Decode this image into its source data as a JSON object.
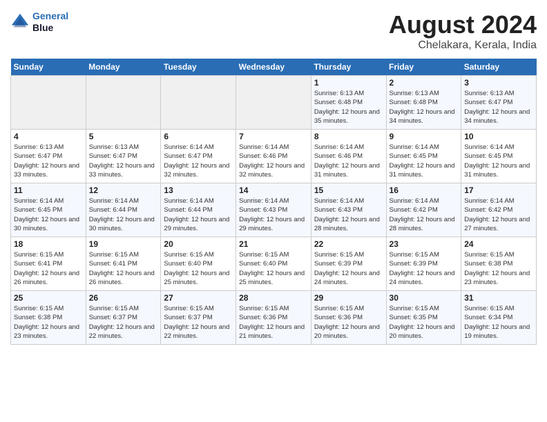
{
  "header": {
    "logo_line1": "General",
    "logo_line2": "Blue",
    "title": "August 2024",
    "subtitle": "Chelakara, Kerala, India"
  },
  "days_of_week": [
    "Sunday",
    "Monday",
    "Tuesday",
    "Wednesday",
    "Thursday",
    "Friday",
    "Saturday"
  ],
  "weeks": [
    [
      {
        "day": "",
        "info": ""
      },
      {
        "day": "",
        "info": ""
      },
      {
        "day": "",
        "info": ""
      },
      {
        "day": "",
        "info": ""
      },
      {
        "day": "1",
        "info": "Sunrise: 6:13 AM\nSunset: 6:48 PM\nDaylight: 12 hours and 35 minutes."
      },
      {
        "day": "2",
        "info": "Sunrise: 6:13 AM\nSunset: 6:48 PM\nDaylight: 12 hours and 34 minutes."
      },
      {
        "day": "3",
        "info": "Sunrise: 6:13 AM\nSunset: 6:47 PM\nDaylight: 12 hours and 34 minutes."
      }
    ],
    [
      {
        "day": "4",
        "info": "Sunrise: 6:13 AM\nSunset: 6:47 PM\nDaylight: 12 hours and 33 minutes."
      },
      {
        "day": "5",
        "info": "Sunrise: 6:13 AM\nSunset: 6:47 PM\nDaylight: 12 hours and 33 minutes."
      },
      {
        "day": "6",
        "info": "Sunrise: 6:14 AM\nSunset: 6:47 PM\nDaylight: 12 hours and 32 minutes."
      },
      {
        "day": "7",
        "info": "Sunrise: 6:14 AM\nSunset: 6:46 PM\nDaylight: 12 hours and 32 minutes."
      },
      {
        "day": "8",
        "info": "Sunrise: 6:14 AM\nSunset: 6:46 PM\nDaylight: 12 hours and 31 minutes."
      },
      {
        "day": "9",
        "info": "Sunrise: 6:14 AM\nSunset: 6:45 PM\nDaylight: 12 hours and 31 minutes."
      },
      {
        "day": "10",
        "info": "Sunrise: 6:14 AM\nSunset: 6:45 PM\nDaylight: 12 hours and 31 minutes."
      }
    ],
    [
      {
        "day": "11",
        "info": "Sunrise: 6:14 AM\nSunset: 6:45 PM\nDaylight: 12 hours and 30 minutes."
      },
      {
        "day": "12",
        "info": "Sunrise: 6:14 AM\nSunset: 6:44 PM\nDaylight: 12 hours and 30 minutes."
      },
      {
        "day": "13",
        "info": "Sunrise: 6:14 AM\nSunset: 6:44 PM\nDaylight: 12 hours and 29 minutes."
      },
      {
        "day": "14",
        "info": "Sunrise: 6:14 AM\nSunset: 6:43 PM\nDaylight: 12 hours and 29 minutes."
      },
      {
        "day": "15",
        "info": "Sunrise: 6:14 AM\nSunset: 6:43 PM\nDaylight: 12 hours and 28 minutes."
      },
      {
        "day": "16",
        "info": "Sunrise: 6:14 AM\nSunset: 6:42 PM\nDaylight: 12 hours and 28 minutes."
      },
      {
        "day": "17",
        "info": "Sunrise: 6:14 AM\nSunset: 6:42 PM\nDaylight: 12 hours and 27 minutes."
      }
    ],
    [
      {
        "day": "18",
        "info": "Sunrise: 6:15 AM\nSunset: 6:41 PM\nDaylight: 12 hours and 26 minutes."
      },
      {
        "day": "19",
        "info": "Sunrise: 6:15 AM\nSunset: 6:41 PM\nDaylight: 12 hours and 26 minutes."
      },
      {
        "day": "20",
        "info": "Sunrise: 6:15 AM\nSunset: 6:40 PM\nDaylight: 12 hours and 25 minutes."
      },
      {
        "day": "21",
        "info": "Sunrise: 6:15 AM\nSunset: 6:40 PM\nDaylight: 12 hours and 25 minutes."
      },
      {
        "day": "22",
        "info": "Sunrise: 6:15 AM\nSunset: 6:39 PM\nDaylight: 12 hours and 24 minutes."
      },
      {
        "day": "23",
        "info": "Sunrise: 6:15 AM\nSunset: 6:39 PM\nDaylight: 12 hours and 24 minutes."
      },
      {
        "day": "24",
        "info": "Sunrise: 6:15 AM\nSunset: 6:38 PM\nDaylight: 12 hours and 23 minutes."
      }
    ],
    [
      {
        "day": "25",
        "info": "Sunrise: 6:15 AM\nSunset: 6:38 PM\nDaylight: 12 hours and 23 minutes."
      },
      {
        "day": "26",
        "info": "Sunrise: 6:15 AM\nSunset: 6:37 PM\nDaylight: 12 hours and 22 minutes."
      },
      {
        "day": "27",
        "info": "Sunrise: 6:15 AM\nSunset: 6:37 PM\nDaylight: 12 hours and 22 minutes."
      },
      {
        "day": "28",
        "info": "Sunrise: 6:15 AM\nSunset: 6:36 PM\nDaylight: 12 hours and 21 minutes."
      },
      {
        "day": "29",
        "info": "Sunrise: 6:15 AM\nSunset: 6:36 PM\nDaylight: 12 hours and 20 minutes."
      },
      {
        "day": "30",
        "info": "Sunrise: 6:15 AM\nSunset: 6:35 PM\nDaylight: 12 hours and 20 minutes."
      },
      {
        "day": "31",
        "info": "Sunrise: 6:15 AM\nSunset: 6:34 PM\nDaylight: 12 hours and 19 minutes."
      }
    ]
  ]
}
